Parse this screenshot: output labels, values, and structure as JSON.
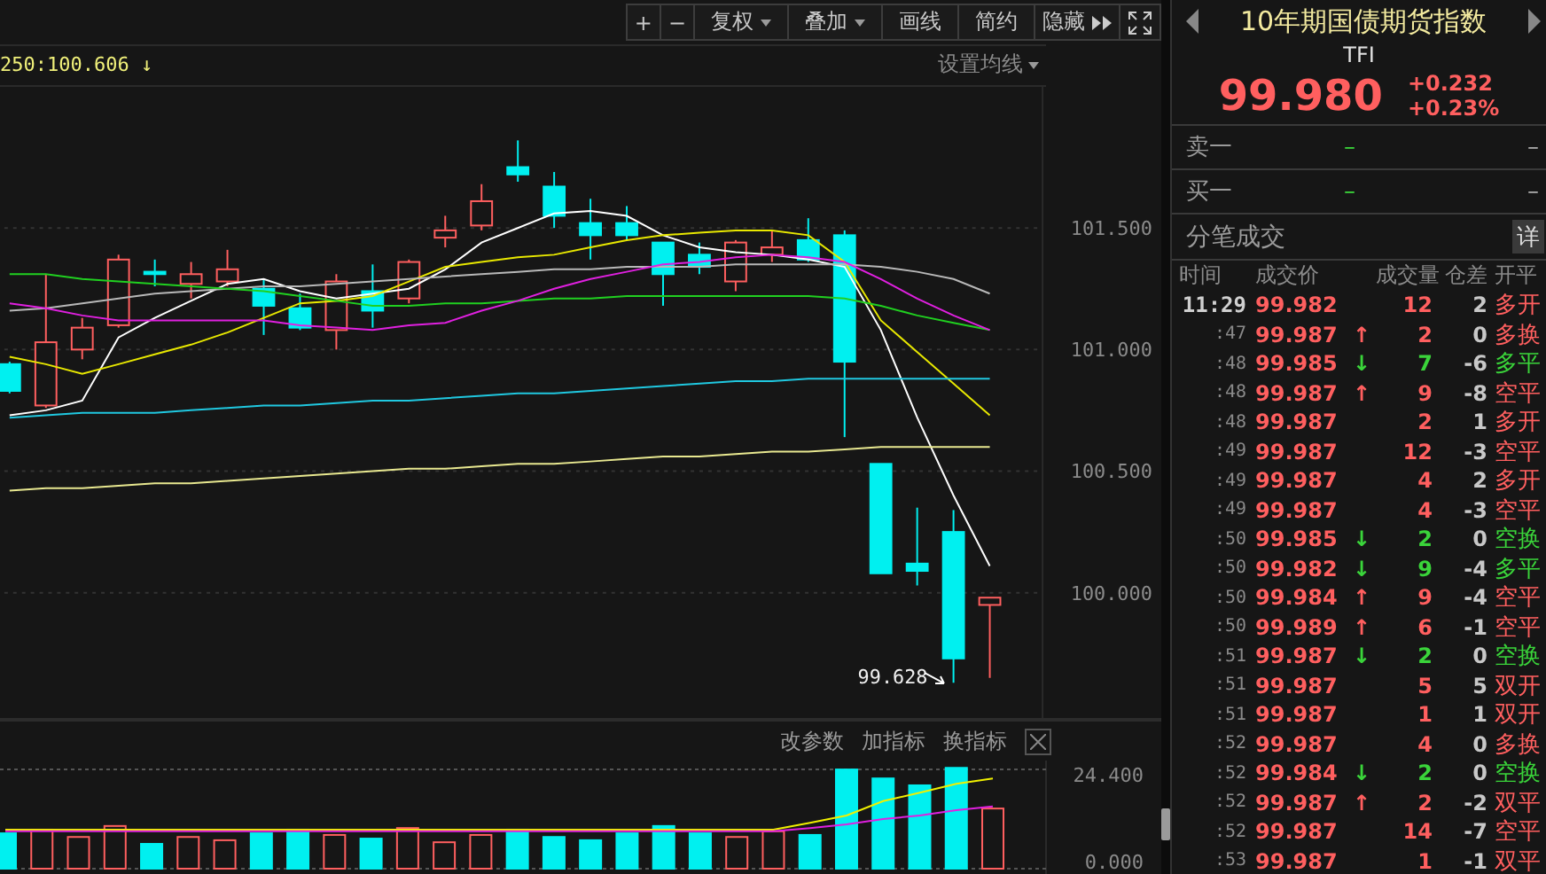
{
  "toolbar": {
    "buttons": [
      {
        "label": "+",
        "kind": "plain"
      },
      {
        "label": "−",
        "kind": "plain"
      },
      {
        "label": "复权",
        "kind": "dropdown"
      },
      {
        "label": "叠加",
        "kind": "dropdown"
      },
      {
        "label": "画线",
        "kind": "plain"
      },
      {
        "label": "简约",
        "kind": "plain"
      },
      {
        "label": "隐藏",
        "kind": "collapse"
      }
    ]
  },
  "ma_legend": {
    "text": "250:100.606",
    "arrow": "↓"
  },
  "ma_settings": "设置均线",
  "price_chart": {
    "low_marker": "99.628",
    "chart_data": {
      "type": "candlestick",
      "grid": true,
      "ylim": [
        99.49,
        102.08
      ],
      "yticks": [
        {
          "value": 101.5,
          "label": "101.500"
        },
        {
          "value": 101.0,
          "label": "101.000"
        },
        {
          "value": 100.5,
          "label": "100.500"
        },
        {
          "value": 100.0,
          "label": "100.000"
        }
      ],
      "ohlc": [
        [
          100.94,
          100.95,
          100.82,
          100.83
        ],
        [
          100.77,
          101.31,
          100.76,
          101.03
        ],
        [
          101.0,
          101.13,
          100.96,
          101.09
        ],
        [
          101.1,
          101.39,
          101.09,
          101.37
        ],
        [
          101.32,
          101.37,
          101.26,
          101.31
        ],
        [
          101.27,
          101.36,
          101.21,
          101.31
        ],
        [
          101.28,
          101.41,
          101.26,
          101.33
        ],
        [
          101.25,
          101.29,
          101.06,
          101.18
        ],
        [
          101.17,
          101.23,
          101.08,
          101.09
        ],
        [
          101.08,
          101.31,
          101.0,
          101.28
        ],
        [
          101.24,
          101.35,
          101.09,
          101.16
        ],
        [
          101.21,
          101.37,
          101.19,
          101.36
        ],
        [
          101.46,
          101.55,
          101.42,
          101.49
        ],
        [
          101.51,
          101.68,
          101.49,
          101.61
        ],
        [
          101.75,
          101.86,
          101.69,
          101.72
        ],
        [
          101.67,
          101.73,
          101.5,
          101.55
        ],
        [
          101.52,
          101.62,
          101.37,
          101.47
        ],
        [
          101.52,
          101.59,
          101.45,
          101.47
        ],
        [
          101.44,
          101.44,
          101.18,
          101.31
        ],
        [
          101.39,
          101.44,
          101.31,
          101.34
        ],
        [
          101.28,
          101.45,
          101.24,
          101.44
        ],
        [
          101.39,
          101.49,
          101.36,
          101.42
        ],
        [
          101.45,
          101.54,
          101.36,
          101.37
        ],
        [
          101.47,
          101.49,
          100.64,
          100.95
        ],
        [
          100.53,
          100.53,
          100.08,
          100.08
        ],
        [
          100.12,
          100.35,
          100.03,
          100.09
        ],
        [
          100.25,
          100.34,
          99.63,
          99.73
        ],
        [
          99.95,
          99.98,
          99.65,
          99.98
        ]
      ],
      "series": [
        {
          "type": "line",
          "color": "#ffffff",
          "values": [
            100.73,
            100.75,
            100.79,
            101.05,
            101.13,
            101.2,
            101.27,
            101.29,
            101.24,
            101.21,
            101.23,
            101.25,
            101.33,
            101.44,
            101.5,
            101.56,
            101.57,
            101.55,
            101.47,
            101.42,
            101.4,
            101.39,
            101.37,
            101.34,
            101.08,
            100.72,
            100.4,
            100.11
          ]
        },
        {
          "type": "line",
          "color": "#e8e800",
          "values": [
            100.97,
            100.94,
            100.9,
            100.94,
            100.98,
            101.02,
            101.07,
            101.13,
            101.19,
            101.2,
            101.22,
            101.28,
            101.34,
            101.36,
            101.38,
            101.39,
            101.42,
            101.45,
            101.47,
            101.48,
            101.49,
            101.49,
            101.47,
            101.36,
            101.12,
            100.99,
            100.86,
            100.73
          ]
        },
        {
          "type": "line",
          "color": "#b8b8b8",
          "values": [
            101.16,
            101.17,
            101.19,
            101.21,
            101.23,
            101.24,
            101.25,
            101.26,
            101.26,
            101.27,
            101.28,
            101.29,
            101.3,
            101.31,
            101.32,
            101.33,
            101.33,
            101.34,
            101.34,
            101.34,
            101.35,
            101.35,
            101.35,
            101.35,
            101.34,
            101.32,
            101.29,
            101.23
          ]
        },
        {
          "type": "line",
          "color": "#20d020",
          "values": [
            101.31,
            101.31,
            101.29,
            101.28,
            101.27,
            101.26,
            101.25,
            101.24,
            101.22,
            101.2,
            101.18,
            101.18,
            101.19,
            101.19,
            101.2,
            101.21,
            101.21,
            101.22,
            101.22,
            101.22,
            101.22,
            101.22,
            101.22,
            101.21,
            101.18,
            101.14,
            101.11,
            101.08
          ]
        },
        {
          "type": "line",
          "color": "#e020e0",
          "values": [
            101.19,
            101.17,
            101.14,
            101.12,
            101.12,
            101.12,
            101.12,
            101.12,
            101.1,
            101.09,
            101.08,
            101.1,
            101.11,
            101.16,
            101.2,
            101.25,
            101.29,
            101.32,
            101.35,
            101.36,
            101.38,
            101.39,
            101.38,
            101.36,
            101.29,
            101.21,
            101.14,
            101.08
          ]
        },
        {
          "type": "line",
          "color": "#20c8e0",
          "values": [
            100.72,
            100.73,
            100.74,
            100.74,
            100.74,
            100.75,
            100.76,
            100.77,
            100.77,
            100.78,
            100.79,
            100.79,
            100.8,
            100.81,
            100.82,
            100.82,
            100.83,
            100.84,
            100.85,
            100.86,
            100.87,
            100.87,
            100.88,
            100.88,
            100.88,
            100.88,
            100.88,
            100.88
          ]
        },
        {
          "type": "line",
          "color": "#e8e890",
          "values": [
            100.42,
            100.43,
            100.43,
            100.44,
            100.45,
            100.45,
            100.46,
            100.47,
            100.48,
            100.49,
            100.5,
            100.51,
            100.51,
            100.52,
            100.53,
            100.53,
            100.54,
            100.55,
            100.56,
            100.56,
            100.57,
            100.58,
            100.58,
            100.59,
            100.6,
            100.6,
            100.6,
            100.6
          ]
        }
      ]
    }
  },
  "indicator": {
    "buttons": [
      "改参数",
      "加指标",
      "换指标"
    ],
    "chart_data": {
      "type": "bar",
      "grid": true,
      "ylim": [
        0,
        26.6
      ],
      "yticks": [
        {
          "value": 24.4,
          "label": "24.400"
        },
        {
          "value": 0,
          "label": "0.000"
        }
      ],
      "values": [
        8.7,
        9.6,
        7.8,
        10.5,
        6.1,
        7.8,
        7.0,
        8.7,
        9.6,
        8.3,
        7.4,
        10.0,
        6.5,
        8.3,
        9.6,
        7.8,
        7.0,
        8.7,
        10.5,
        8.7,
        7.8,
        9.2,
        8.3,
        24.4,
        22.2,
        20.5,
        24.8,
        14.8
      ],
      "colors": [
        "#00f0f0",
        "#ff5f5f",
        "#ff5f5f",
        "#ff5f5f",
        "#00f0f0",
        "#ff5f5f",
        "#ff5f5f",
        "#00f0f0",
        "#00f0f0",
        "#ff5f5f",
        "#00f0f0",
        "#ff5f5f",
        "#ff5f5f",
        "#ff5f5f",
        "#00f0f0",
        "#00f0f0",
        "#00f0f0",
        "#00f0f0",
        "#00f0f0",
        "#00f0f0",
        "#ff5f5f",
        "#ff5f5f",
        "#00f0f0",
        "#00f0f0",
        "#00f0f0",
        "#00f0f0",
        "#00f0f0",
        "#ff5f5f"
      ],
      "series": [
        {
          "type": "line",
          "color": "#f0f000",
          "values": [
            9.6,
            9.6,
            9.6,
            9.6,
            9.6,
            9.6,
            9.6,
            9.6,
            9.6,
            9.6,
            9.6,
            9.6,
            9.6,
            9.6,
            9.6,
            9.6,
            9.6,
            9.6,
            9.6,
            9.6,
            9.6,
            9.6,
            11.3,
            13.1,
            16.6,
            18.7,
            20.9,
            22.2
          ]
        },
        {
          "type": "line",
          "color": "#e020e0",
          "values": [
            9.2,
            9.2,
            9.2,
            9.2,
            9.2,
            9.2,
            9.2,
            9.2,
            9.2,
            9.2,
            9.2,
            9.2,
            9.2,
            9.2,
            9.2,
            9.2,
            9.2,
            9.2,
            9.2,
            9.2,
            9.2,
            9.2,
            10.0,
            10.9,
            12.2,
            13.1,
            14.4,
            15.3
          ]
        }
      ]
    }
  },
  "quote": {
    "title": "10年期国债期货指数",
    "code": "TFI",
    "price": "99.980",
    "change": "+0.232",
    "change_pct": "+0.23%"
  },
  "order_book": [
    {
      "label": "卖一",
      "price": "–",
      "volume": "–"
    },
    {
      "label": "买一",
      "price": "–",
      "volume": "–"
    }
  ],
  "trades": {
    "title": "分笔成交",
    "detail_button": "详",
    "columns": [
      "时间",
      "成交价",
      "成交量",
      "仓差",
      "开平"
    ],
    "rows": [
      {
        "time": "11:29",
        "price": "99.982",
        "volume": "12",
        "diff": "2",
        "type": "多开",
        "color": "#ff5f5f"
      },
      {
        "time": ":47",
        "price": "99.987",
        "arrow": "↑",
        "volume": "2",
        "diff": "0",
        "type": "多换",
        "color": "#ff5f5f"
      },
      {
        "time": ":48",
        "price": "99.985",
        "arrow": "↓",
        "volume": "7",
        "diff": "-6",
        "type": "多平",
        "color": "#3ad43a"
      },
      {
        "time": ":48",
        "price": "99.987",
        "arrow": "↑",
        "volume": "9",
        "diff": "-8",
        "type": "空平",
        "color": "#ff5f5f"
      },
      {
        "time": ":48",
        "price": "99.987",
        "volume": "2",
        "diff": "1",
        "type": "多开",
        "color": "#ff5f5f"
      },
      {
        "time": ":49",
        "price": "99.987",
        "volume": "12",
        "diff": "-3",
        "type": "空平",
        "color": "#ff5f5f"
      },
      {
        "time": ":49",
        "price": "99.987",
        "volume": "4",
        "diff": "2",
        "type": "多开",
        "color": "#ff5f5f"
      },
      {
        "time": ":49",
        "price": "99.987",
        "volume": "4",
        "diff": "-3",
        "type": "空平",
        "color": "#ff5f5f"
      },
      {
        "time": ":50",
        "price": "99.985",
        "arrow": "↓",
        "volume": "2",
        "diff": "0",
        "type": "空换",
        "color": "#3ad43a"
      },
      {
        "time": ":50",
        "price": "99.982",
        "arrow": "↓",
        "volume": "9",
        "diff": "-4",
        "type": "多平",
        "color": "#3ad43a"
      },
      {
        "time": ":50",
        "price": "99.984",
        "arrow": "↑",
        "volume": "9",
        "diff": "-4",
        "type": "空平",
        "color": "#ff5f5f"
      },
      {
        "time": ":50",
        "price": "99.989",
        "arrow": "↑",
        "volume": "6",
        "diff": "-1",
        "type": "空平",
        "color": "#ff5f5f"
      },
      {
        "time": ":51",
        "price": "99.987",
        "arrow": "↓",
        "volume": "2",
        "diff": "0",
        "type": "空换",
        "color": "#3ad43a"
      },
      {
        "time": ":51",
        "price": "99.987",
        "volume": "5",
        "diff": "5",
        "type": "双开",
        "color": "#ff5f5f"
      },
      {
        "time": ":51",
        "price": "99.987",
        "volume": "1",
        "diff": "1",
        "type": "双开",
        "color": "#ff5f5f"
      },
      {
        "time": ":52",
        "price": "99.987",
        "volume": "4",
        "diff": "0",
        "type": "多换",
        "color": "#ff5f5f"
      },
      {
        "time": ":52",
        "price": "99.984",
        "arrow": "↓",
        "volume": "2",
        "diff": "0",
        "type": "空换",
        "color": "#3ad43a"
      },
      {
        "time": ":52",
        "price": "99.987",
        "arrow": "↑",
        "volume": "2",
        "diff": "-2",
        "type": "双平",
        "color": "#ff5f5f"
      },
      {
        "time": ":52",
        "price": "99.987",
        "volume": "14",
        "diff": "-7",
        "type": "空平",
        "color": "#ff5f5f"
      },
      {
        "time": ":53",
        "price": "99.987",
        "volume": "1",
        "diff": "-1",
        "type": "双平",
        "color": "#ff5f5f"
      }
    ]
  }
}
